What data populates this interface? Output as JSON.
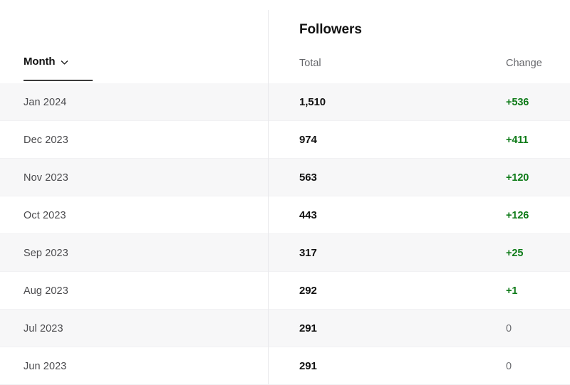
{
  "header": {
    "month_column": {
      "label": "Month",
      "sort_icon": "chevron-down-icon",
      "active": true
    },
    "group_title": "Followers",
    "sub_headers": {
      "total": "Total",
      "change": "Change"
    }
  },
  "colors": {
    "positive_change": "#0d7a17",
    "neutral_change": "#6b6c70",
    "total_value": "#121212",
    "month_label": "#4b4b4e",
    "row_alt_background": "#f7f7f8",
    "row_background": "#ffffff",
    "divider": "#e9e9ec",
    "sort_underline": "#3b3b3b"
  },
  "table_data": {
    "type": "table",
    "columns": [
      "Month",
      "Total",
      "Change"
    ],
    "rows": [
      {
        "month": "Jan 2024",
        "total": "1,510",
        "change": "+536",
        "change_value": 536,
        "total_value": 1510,
        "positive": true
      },
      {
        "month": "Dec 2023",
        "total": "974",
        "change": "+411",
        "change_value": 411,
        "total_value": 974,
        "positive": true
      },
      {
        "month": "Nov 2023",
        "total": "563",
        "change": "+120",
        "change_value": 120,
        "total_value": 563,
        "positive": true
      },
      {
        "month": "Oct 2023",
        "total": "443",
        "change": "+126",
        "change_value": 126,
        "total_value": 443,
        "positive": true
      },
      {
        "month": "Sep 2023",
        "total": "317",
        "change": "+25",
        "change_value": 25,
        "total_value": 317,
        "positive": true
      },
      {
        "month": "Aug 2023",
        "total": "292",
        "change": "+1",
        "change_value": 1,
        "total_value": 292,
        "positive": true
      },
      {
        "month": "Jul 2023",
        "total": "291",
        "change": "0",
        "change_value": 0,
        "total_value": 291,
        "positive": false
      },
      {
        "month": "Jun 2023",
        "total": "291",
        "change": "0",
        "change_value": 0,
        "total_value": 291,
        "positive": false
      }
    ]
  }
}
